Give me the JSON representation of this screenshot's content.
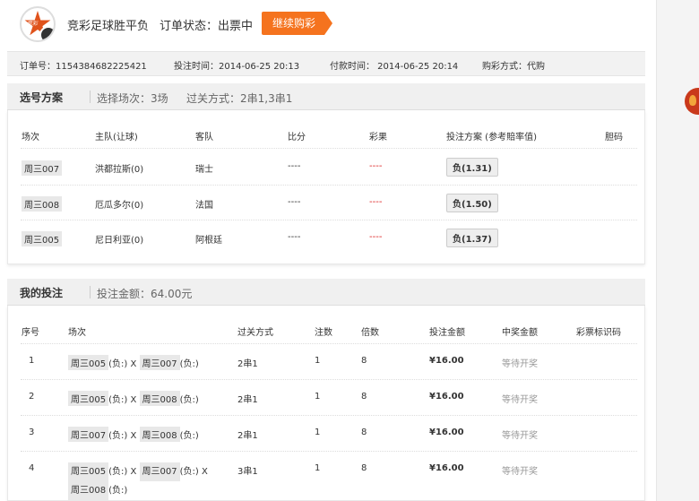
{
  "header": {
    "logo_text": "竞彩",
    "title": "竞彩足球胜平负",
    "status_label": "订单状态：出票中",
    "continue_button": "继续购彩"
  },
  "order_info": {
    "order_no": "订单号：1154384682225421",
    "bet_time": "投注时间：2014-06-25 20:13",
    "pay_time": "付款时间： 2014-06-25 20:14",
    "buy_method": "购彩方式：代购"
  },
  "selection": {
    "heading": "选号方案",
    "matches_count": "选择场次：3场",
    "pass_method": "过关方式：2串1,3串1",
    "columns": [
      "场次",
      "主队(让球)",
      "客队",
      "比分",
      "彩果",
      "投注方案 (参考賠率值)",
      "胆码"
    ],
    "rows": [
      {
        "id": "周三007",
        "home": "洪都拉斯(0)",
        "away": "瑞士",
        "score": "----",
        "result": "----",
        "bet": "负(1.31)"
      },
      {
        "id": "周三008",
        "home": "厄瓜多尔(0)",
        "away": "法国",
        "score": "----",
        "result": "----",
        "bet": "负(1.50)"
      },
      {
        "id": "周三005",
        "home": "尼日利亚(0)",
        "away": "阿根廷",
        "score": "----",
        "result": "----",
        "bet": "负(1.37)"
      }
    ]
  },
  "mybets": {
    "heading": "我的投注",
    "amount": "投注金额：64.00元",
    "columns": [
      "序号",
      "场次",
      "过关方式",
      "注数",
      "倍数",
      "投注金额",
      "中奖金额",
      "彩票标识码"
    ],
    "rows": [
      {
        "no": "1",
        "m1": "周三005",
        "r1": "(负:)",
        "x1": "X",
        "m2": "周三007",
        "r2": "(负:)",
        "pass": "2串1",
        "count": "1",
        "mult": "8",
        "amount": "¥16.00",
        "prize": "等待开奖"
      },
      {
        "no": "2",
        "m1": "周三005",
        "r1": "(负:)",
        "x1": "X",
        "m2": "周三008",
        "r2": "(负:)",
        "pass": "2串1",
        "count": "1",
        "mult": "8",
        "amount": "¥16.00",
        "prize": "等待开奖"
      },
      {
        "no": "3",
        "m1": "周三007",
        "r1": "(负:)",
        "x1": "X",
        "m2": "周三008",
        "r2": "(负:)",
        "pass": "2串1",
        "count": "1",
        "mult": "8",
        "amount": "¥16.00",
        "prize": "等待开奖"
      },
      {
        "no": "4",
        "m1": "周三005",
        "r1": "(负:)",
        "x1": "X",
        "m2": "周三007",
        "r2": "(负:)",
        "x2": "X",
        "m3": "周三008",
        "r3": "(负:)",
        "pass": "3串1",
        "count": "1",
        "mult": "8",
        "amount": "¥16.00",
        "prize": "等待开奖"
      }
    ]
  },
  "colors": {
    "accent": "#f5731e",
    "result_red": "#dd2222"
  }
}
